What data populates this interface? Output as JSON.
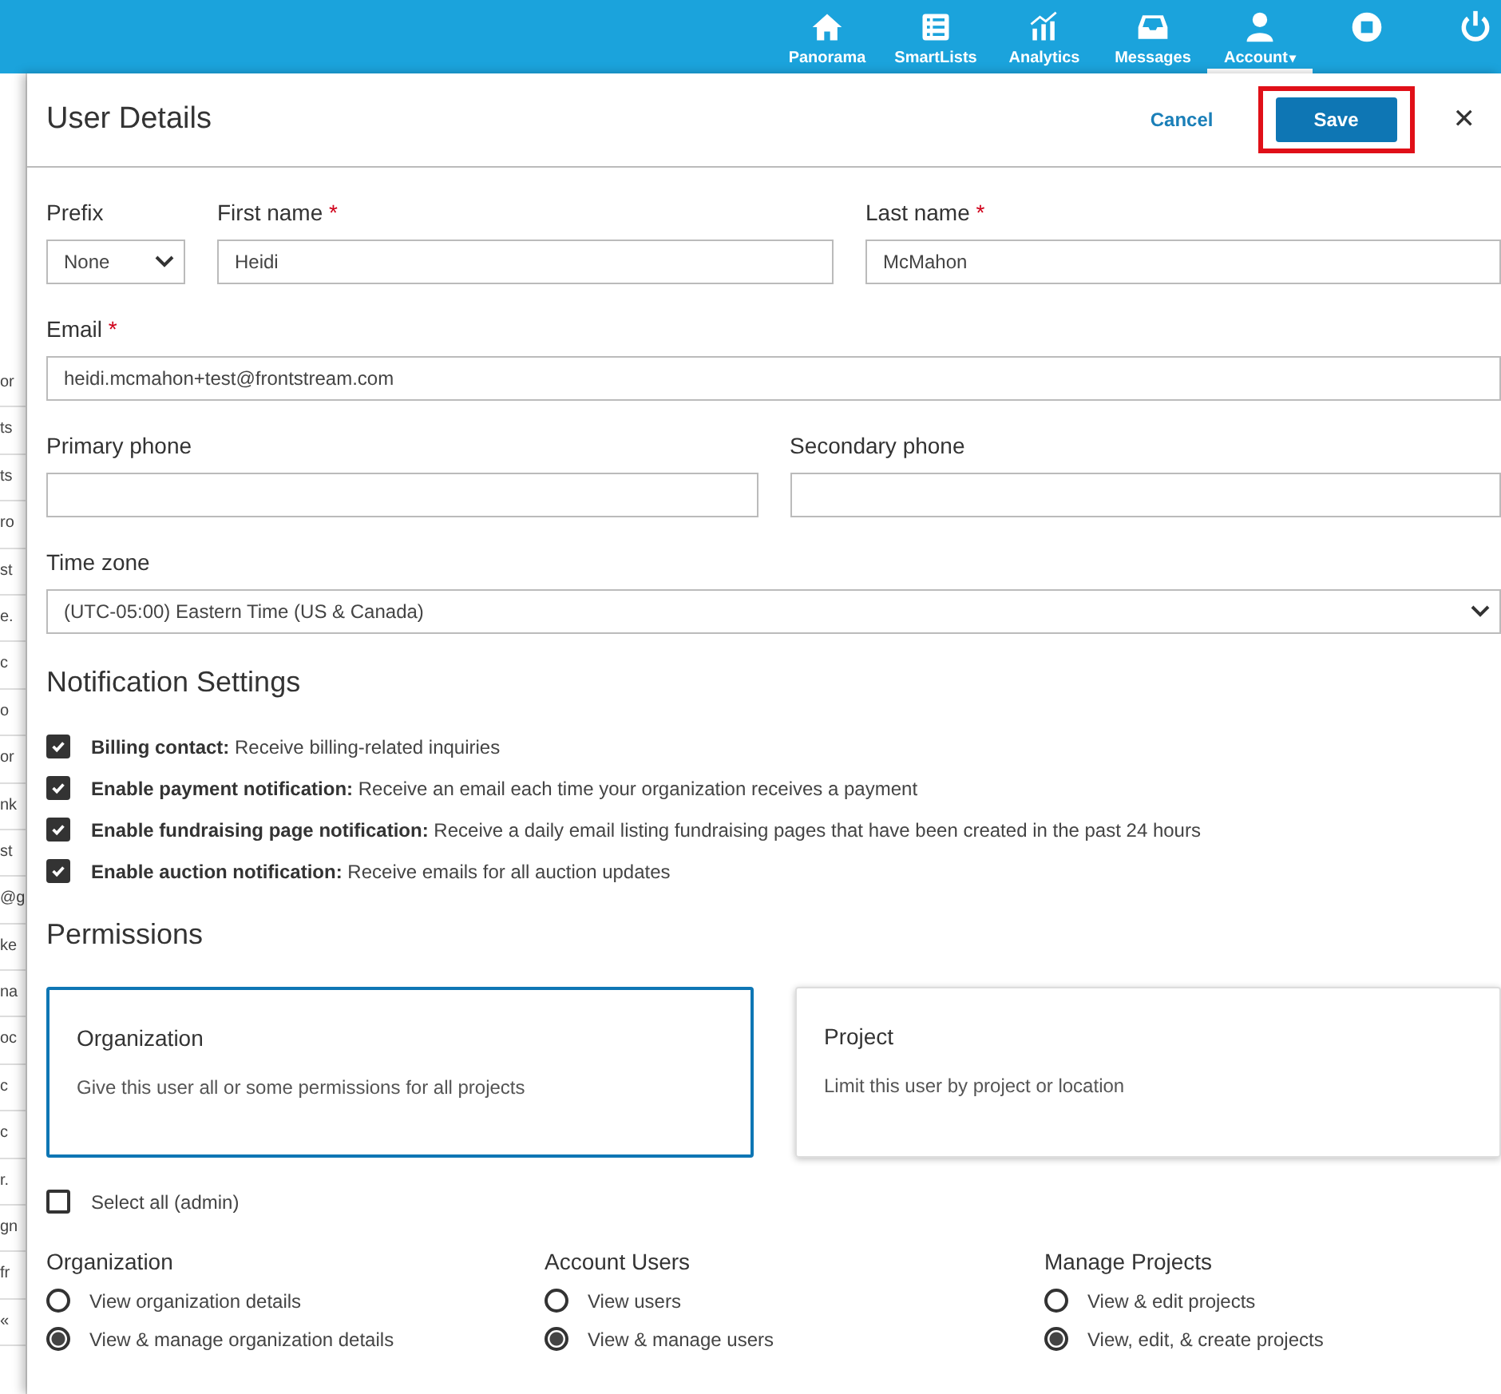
{
  "nav": [
    {
      "label": "Panorama",
      "selected": false
    },
    {
      "label": "SmartLists",
      "selected": false
    },
    {
      "label": "Analytics",
      "selected": false
    },
    {
      "label": "Messages",
      "selected": false
    },
    {
      "label": "Account",
      "selected": true,
      "caret": "▾"
    },
    {
      "selected": false
    },
    {
      "selected": false
    }
  ],
  "background_fragments": [
    "or",
    "ts",
    "ts",
    "ro",
    "st",
    "e.",
    "c",
    "o",
    "or",
    "nk",
    "st",
    "@g",
    "ke",
    "na",
    "oc",
    "c",
    "c",
    "r.",
    "gn",
    "fr",
    "«"
  ],
  "panel": {
    "title": "User Details",
    "cancel": "Cancel",
    "save": "Save",
    "close": "✕"
  },
  "fields": {
    "prefix": {
      "label": "Prefix",
      "value": "None"
    },
    "first_name": {
      "label": "First name",
      "required_mark": "*",
      "value": "Heidi"
    },
    "last_name": {
      "label": "Last name",
      "required_mark": "*",
      "value": "McMahon"
    },
    "email": {
      "label": "Email",
      "required_mark": "*",
      "value": "heidi.mcmahon+test@frontstream.com"
    },
    "primary_phone": {
      "label": "Primary phone"
    },
    "secondary_phone": {
      "label": "Secondary phone"
    },
    "time_zone": {
      "label": "Time zone",
      "value": "(UTC-05:00) Eastern Time (US & Canada)"
    }
  },
  "notifications": {
    "title": "Notification Settings",
    "items": [
      {
        "name": "Billing contact:",
        "text": "Receive billing-related inquiries",
        "checked": true
      },
      {
        "name": "Enable payment notification:",
        "text": "Receive an email each time your organization receives a payment",
        "checked": true
      },
      {
        "name": "Enable fundraising page notification:",
        "text": "Receive a daily email listing fundraising pages that have been created in the past 24 hours",
        "checked": true
      },
      {
        "name": "Enable auction notification:",
        "text": "Receive emails for all auction updates",
        "checked": true
      }
    ]
  },
  "permissions": {
    "title": "Permissions",
    "scopes": [
      {
        "title": "Organization",
        "text": "Give this user all or some permissions for all projects",
        "selected": true
      },
      {
        "title": "Project",
        "text": "Limit this user by project or location",
        "selected": false
      }
    ],
    "select_all": {
      "label": "Select all (admin)",
      "checked": false
    },
    "groups": [
      {
        "title": "Organization",
        "options": [
          {
            "label": "View organization details",
            "selected": false
          },
          {
            "label": "View & manage organization details",
            "selected": true
          }
        ]
      },
      {
        "title": "Account Users",
        "options": [
          {
            "label": "View users",
            "selected": false
          },
          {
            "label": "View & manage users",
            "selected": true
          }
        ]
      },
      {
        "title": "Manage Projects",
        "options": [
          {
            "label": "View & edit projects",
            "selected": false
          },
          {
            "label": "View, edit, & create projects",
            "selected": true
          }
        ]
      }
    ]
  }
}
